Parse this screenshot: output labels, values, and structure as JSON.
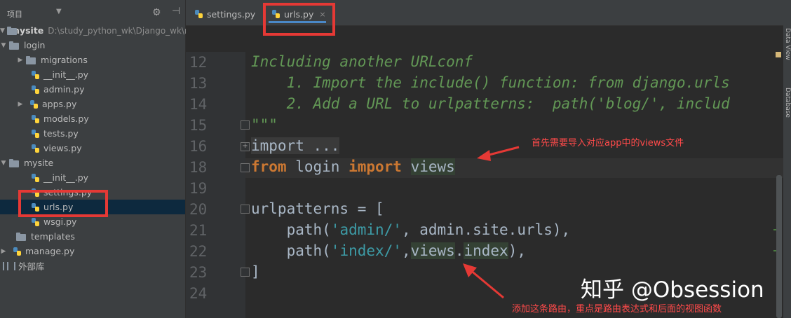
{
  "project_panel": {
    "title": "项目",
    "tree": [
      {
        "label": "mysite",
        "path": "D:\\study_python_wk\\Django_wk\\m"
      },
      {
        "label": "login"
      },
      {
        "label": "migrations"
      },
      {
        "label": "__init__.py"
      },
      {
        "label": "admin.py"
      },
      {
        "label": "apps.py"
      },
      {
        "label": "models.py"
      },
      {
        "label": "tests.py"
      },
      {
        "label": "views.py"
      },
      {
        "label": "mysite"
      },
      {
        "label": "__init__.py"
      },
      {
        "label": "settings.py"
      },
      {
        "label": "urls.py"
      },
      {
        "label": "wsgi.py"
      },
      {
        "label": "templates"
      },
      {
        "label": "manage.py"
      },
      {
        "label": "外部库"
      }
    ]
  },
  "editor_tabs": [
    {
      "label": "settings.py"
    },
    {
      "label": "urls.py",
      "close": "×"
    }
  ],
  "right_tools": [
    "Data View",
    "Database"
  ],
  "code": {
    "line_numbers": [
      "12",
      "13",
      "14",
      "15",
      "16",
      "18",
      "19",
      "20",
      "21",
      "22",
      "23",
      "24"
    ],
    "l12": "Including another URLconf",
    "l13": "    1. Import the include() function: from django.urls",
    "l14": "    2. Add a URL to urlpatterns:  path('blog/', includ",
    "l15": "\"\"\"",
    "l16": "import ...",
    "l18_kw1": "from",
    "l18_mid": " login ",
    "l18_kw2": "import",
    "l18_views": "views",
    "l20": "urlpatterns = [",
    "l21_a": "    path(",
    "l21_str": "'admin/'",
    "l21_b": ", admin.site.urls),",
    "l22_a": "    path(",
    "l22_str": "'index/'",
    "l22_b": ",",
    "l22_views": "views",
    "l22_dot": ".",
    "l22_index": "index",
    "l22_c": "),",
    "l23": "]"
  },
  "annotations": {
    "import_note": "首先需要导入对应app中的views文件",
    "route_note": "添加这条路由，重点是路由表达式和后面的视图函数",
    "watermark": "知乎 @Obsession"
  },
  "colors": {
    "annotation_red": "#e53935",
    "keyword": "#cc7832",
    "comment": "#629755",
    "string": "#3d9ba6"
  }
}
